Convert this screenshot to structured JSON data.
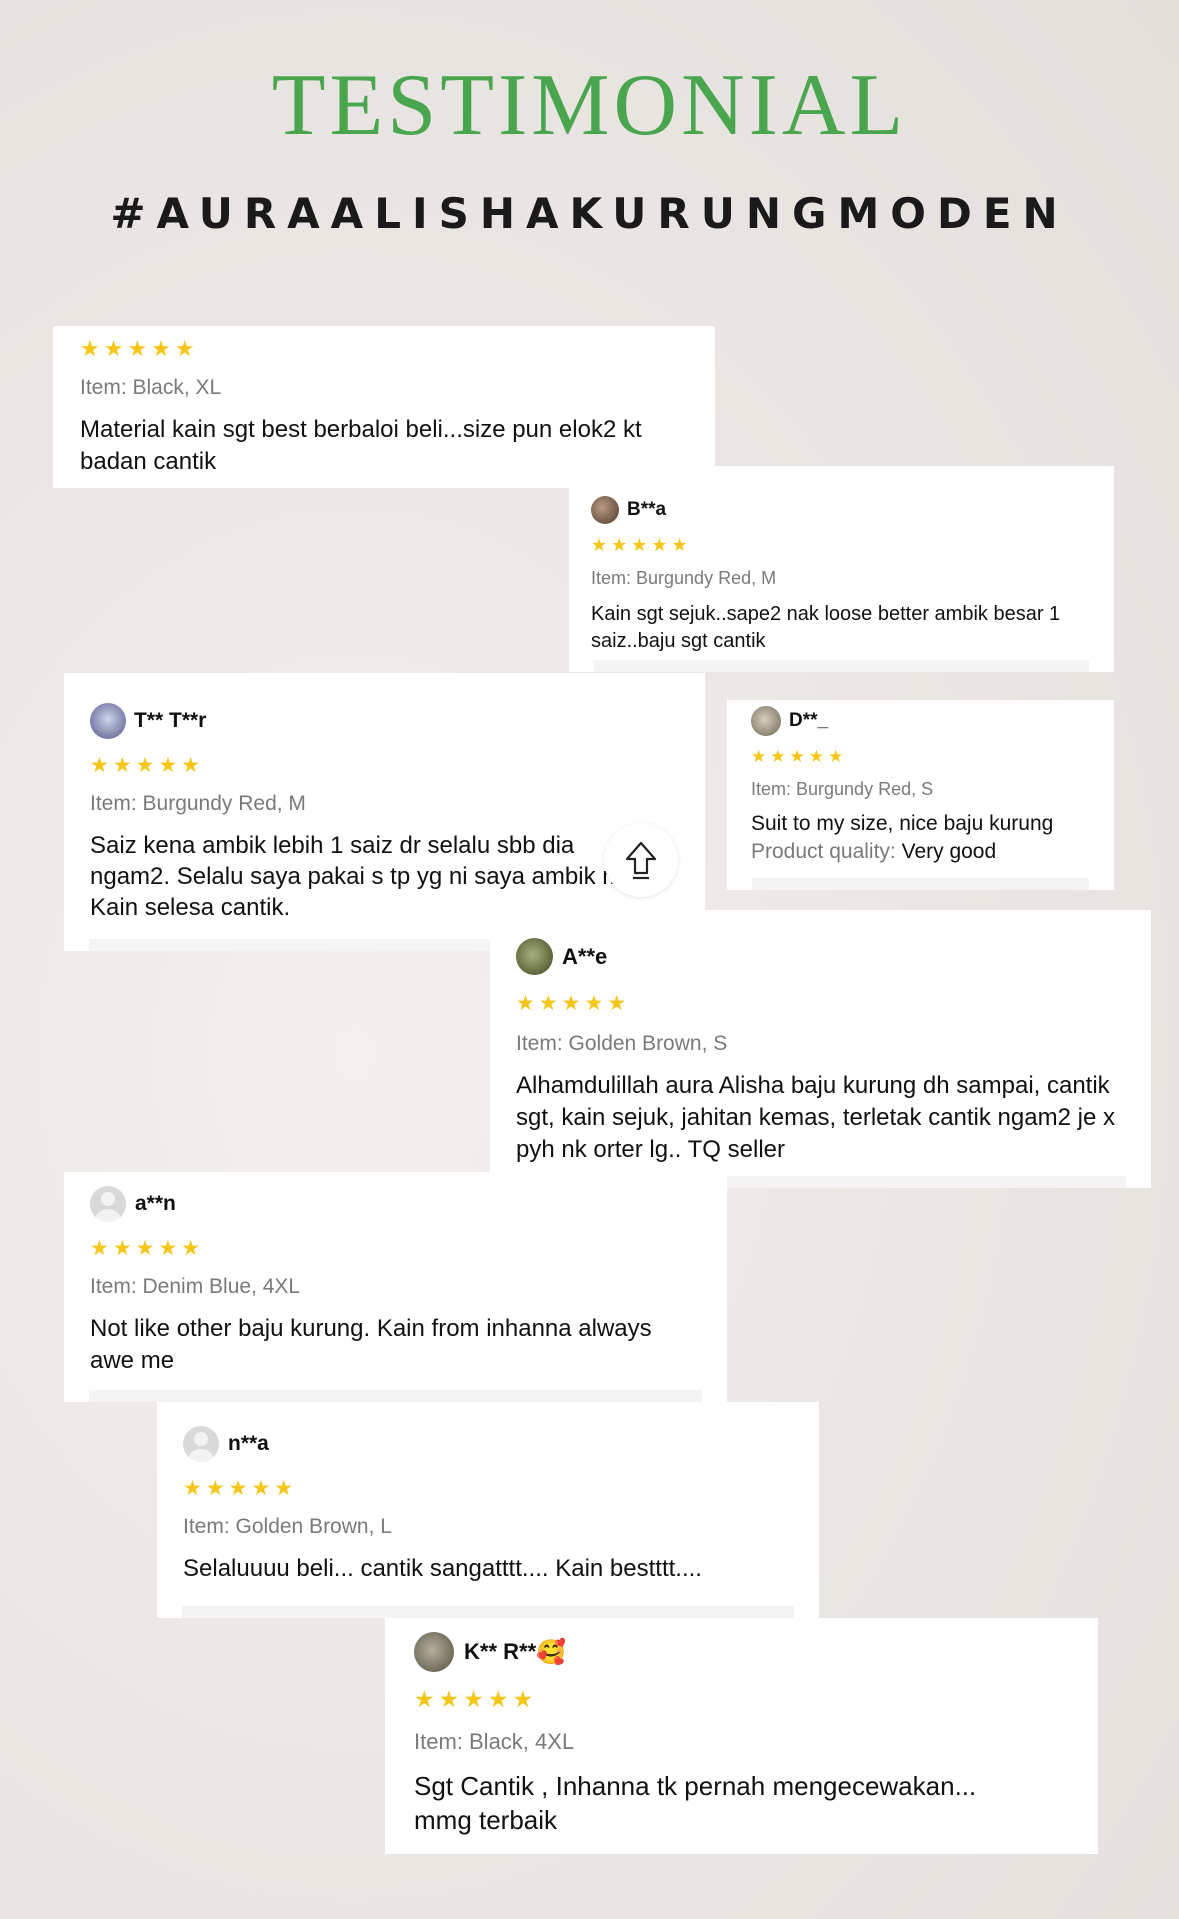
{
  "header": {
    "title": "TESTIMONIAL",
    "hashtag": "#AURAALISHAKURUNGMODEN"
  },
  "stars": "★★★★★",
  "reviews": [
    {
      "user": "",
      "item": "Item: Black, XL",
      "text": "Material kain sgt best berbaloi beli...size pun elok2 kt badan cantik"
    },
    {
      "user": "B**a",
      "item": "Item: Burgundy Red, M",
      "text": "Kain sgt sejuk..sape2 nak loose better ambik besar 1 saiz..baju sgt cantik"
    },
    {
      "user": "T** T**r",
      "item": "Item: Burgundy Red, M",
      "text": "Saiz kena ambik lebih 1 saiz dr selalu sbb dia ngam2. Selalu saya pakai s tp yg ni saya ambik m. Kain selesa cantik."
    },
    {
      "user": "D**_",
      "item": "Item: Burgundy Red, S",
      "text": "Suit to my size, nice baju kurung",
      "quality_label": "Product quality:",
      "quality_value": "Very good"
    },
    {
      "user": "A**e",
      "item": "Item: Golden Brown, S",
      "text": "Alhamdulillah aura Alisha baju kurung dh sampai, cantik sgt, kain sejuk, jahitan kemas, terletak cantik ngam2 je x pyh nk orter lg.. TQ seller"
    },
    {
      "user": "a**n",
      "item": "Item: Denim Blue, 4XL",
      "text": "Not like other baju kurung. Kain from inhanna always awe me"
    },
    {
      "user": "n**a",
      "item": "Item: Golden Brown, L",
      "text": "Selaluuuu beli... cantik sangatttt.... Kain bestttt...."
    },
    {
      "user": "K** R**",
      "emoji": "🥰",
      "item": "Item: Black, 4XL",
      "text": "Sgt Cantik , Inhanna tk pernah mengecewakan... mmg terbaik"
    }
  ],
  "icons": {
    "scroll_top": "arrow-up-icon"
  },
  "colors": {
    "title": "#4aa54f",
    "stars": "#f5c518",
    "item_text": "#7a7a7a"
  }
}
